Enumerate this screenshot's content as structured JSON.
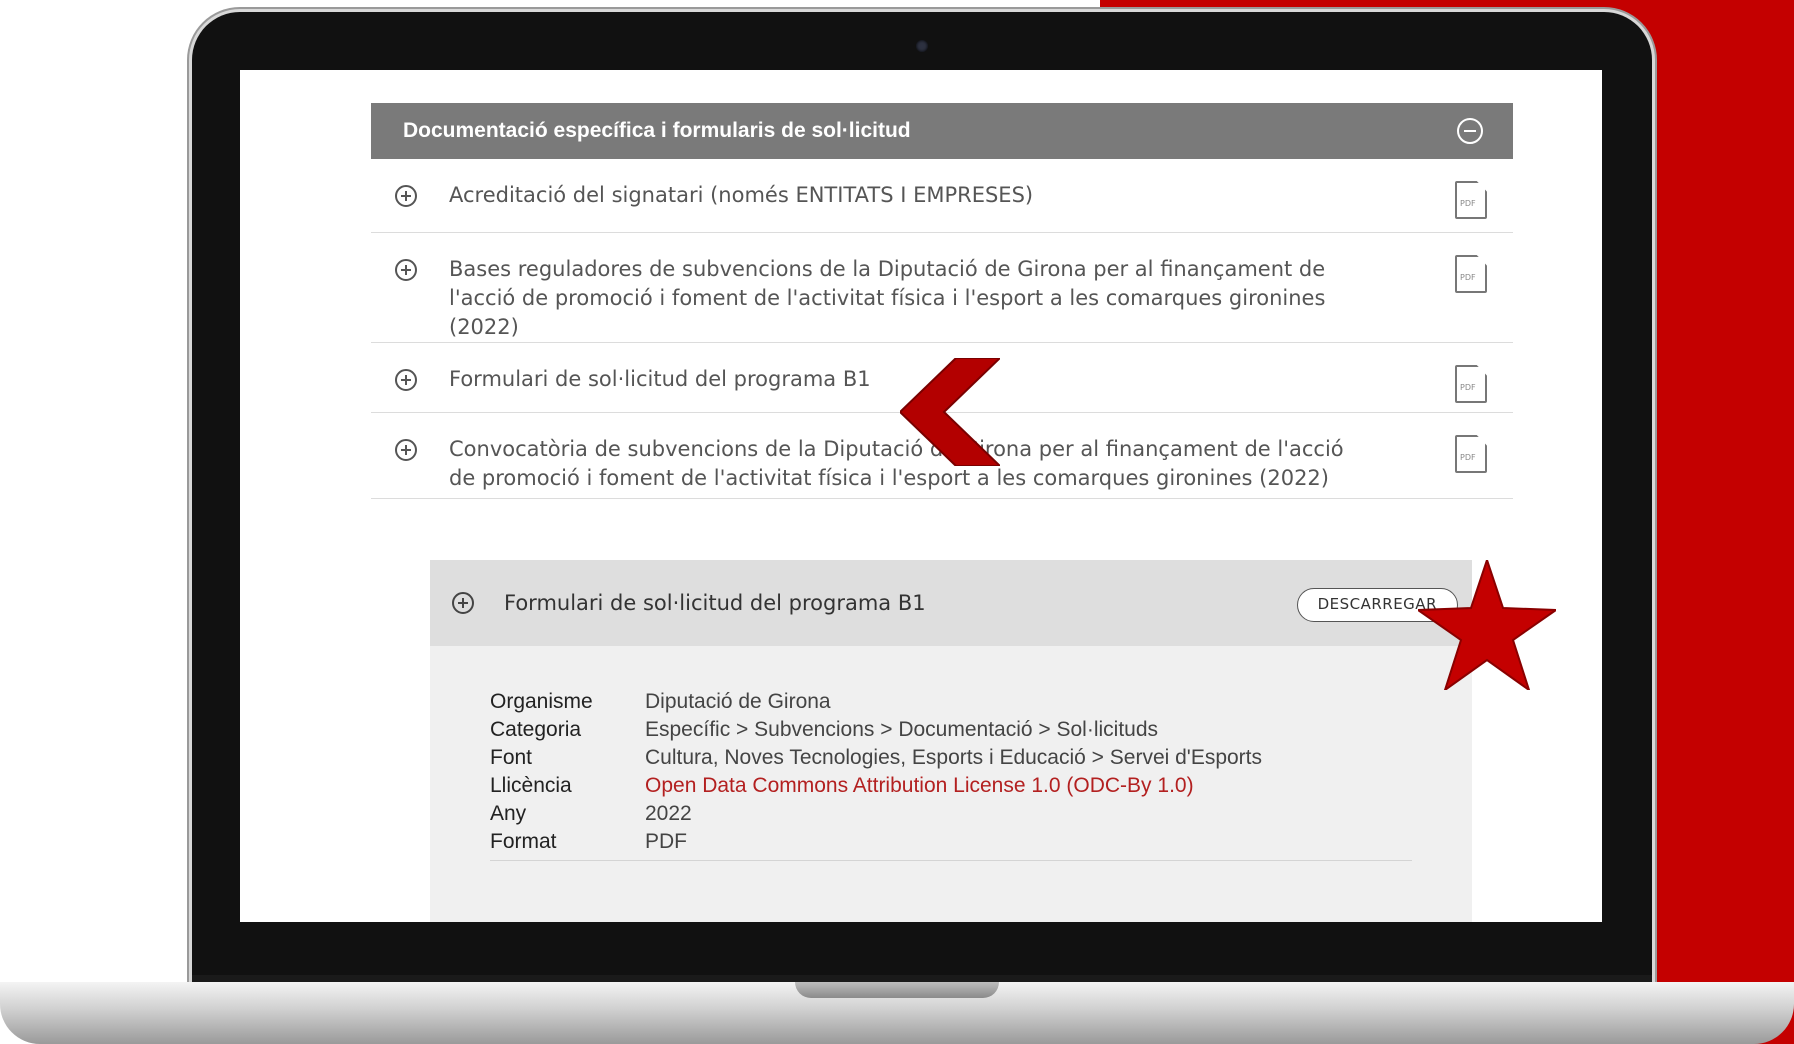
{
  "accordion": {
    "title": "Documentació específica i formularis de sol·licitud",
    "collapse_icon": "minus-circle-icon",
    "items": [
      {
        "label": "Acreditació del signatari (només ENTITATS I EMPRESES)",
        "icon": "plus-circle-icon",
        "file_icon": "pdf-file-icon"
      },
      {
        "label": "Bases reguladores de subvencions de la Diputació de Girona per al finançament de l'acció de promoció i foment de l'activitat física i l'esport a les comarques gironines (2022)",
        "icon": "plus-circle-icon",
        "file_icon": "pdf-file-icon"
      },
      {
        "label": "Formulari de sol·licitud del programa B1",
        "icon": "plus-circle-icon",
        "file_icon": "pdf-file-icon"
      },
      {
        "label": "Convocatòria de subvencions de la Diputació de Girona per al finançament de l'acció de promoció i foment de l'activitat física i l'esport a les comarques gironines (2022)",
        "icon": "plus-circle-icon",
        "file_icon": "pdf-file-icon"
      }
    ]
  },
  "dataset": {
    "title": "Formulari de sol·licitud del programa B1",
    "download_label": "DESCARREGAR",
    "metadata": [
      {
        "label": "Organisme",
        "value": "Diputació de Girona"
      },
      {
        "label": "Categoria",
        "value": "Específic > Subvencions > Documentació > Sol·licituds"
      },
      {
        "label": "Font",
        "value": "Cultura, Noves Tecnologies, Esports i Educació > Servei d'Esports"
      },
      {
        "label": "Llicència",
        "value": "Open Data Commons Attribution License 1.0 (ODC-By 1.0)"
      },
      {
        "label": "Any",
        "value": "2022"
      },
      {
        "label": "Format",
        "value": "PDF"
      }
    ]
  },
  "decorations": {
    "pointer": "red-chevron-icon",
    "highlight": "red-star-icon"
  },
  "colors": {
    "accent_red": "#c40000",
    "header_gray": "#7a7a7a",
    "link_red": "#b32020"
  }
}
